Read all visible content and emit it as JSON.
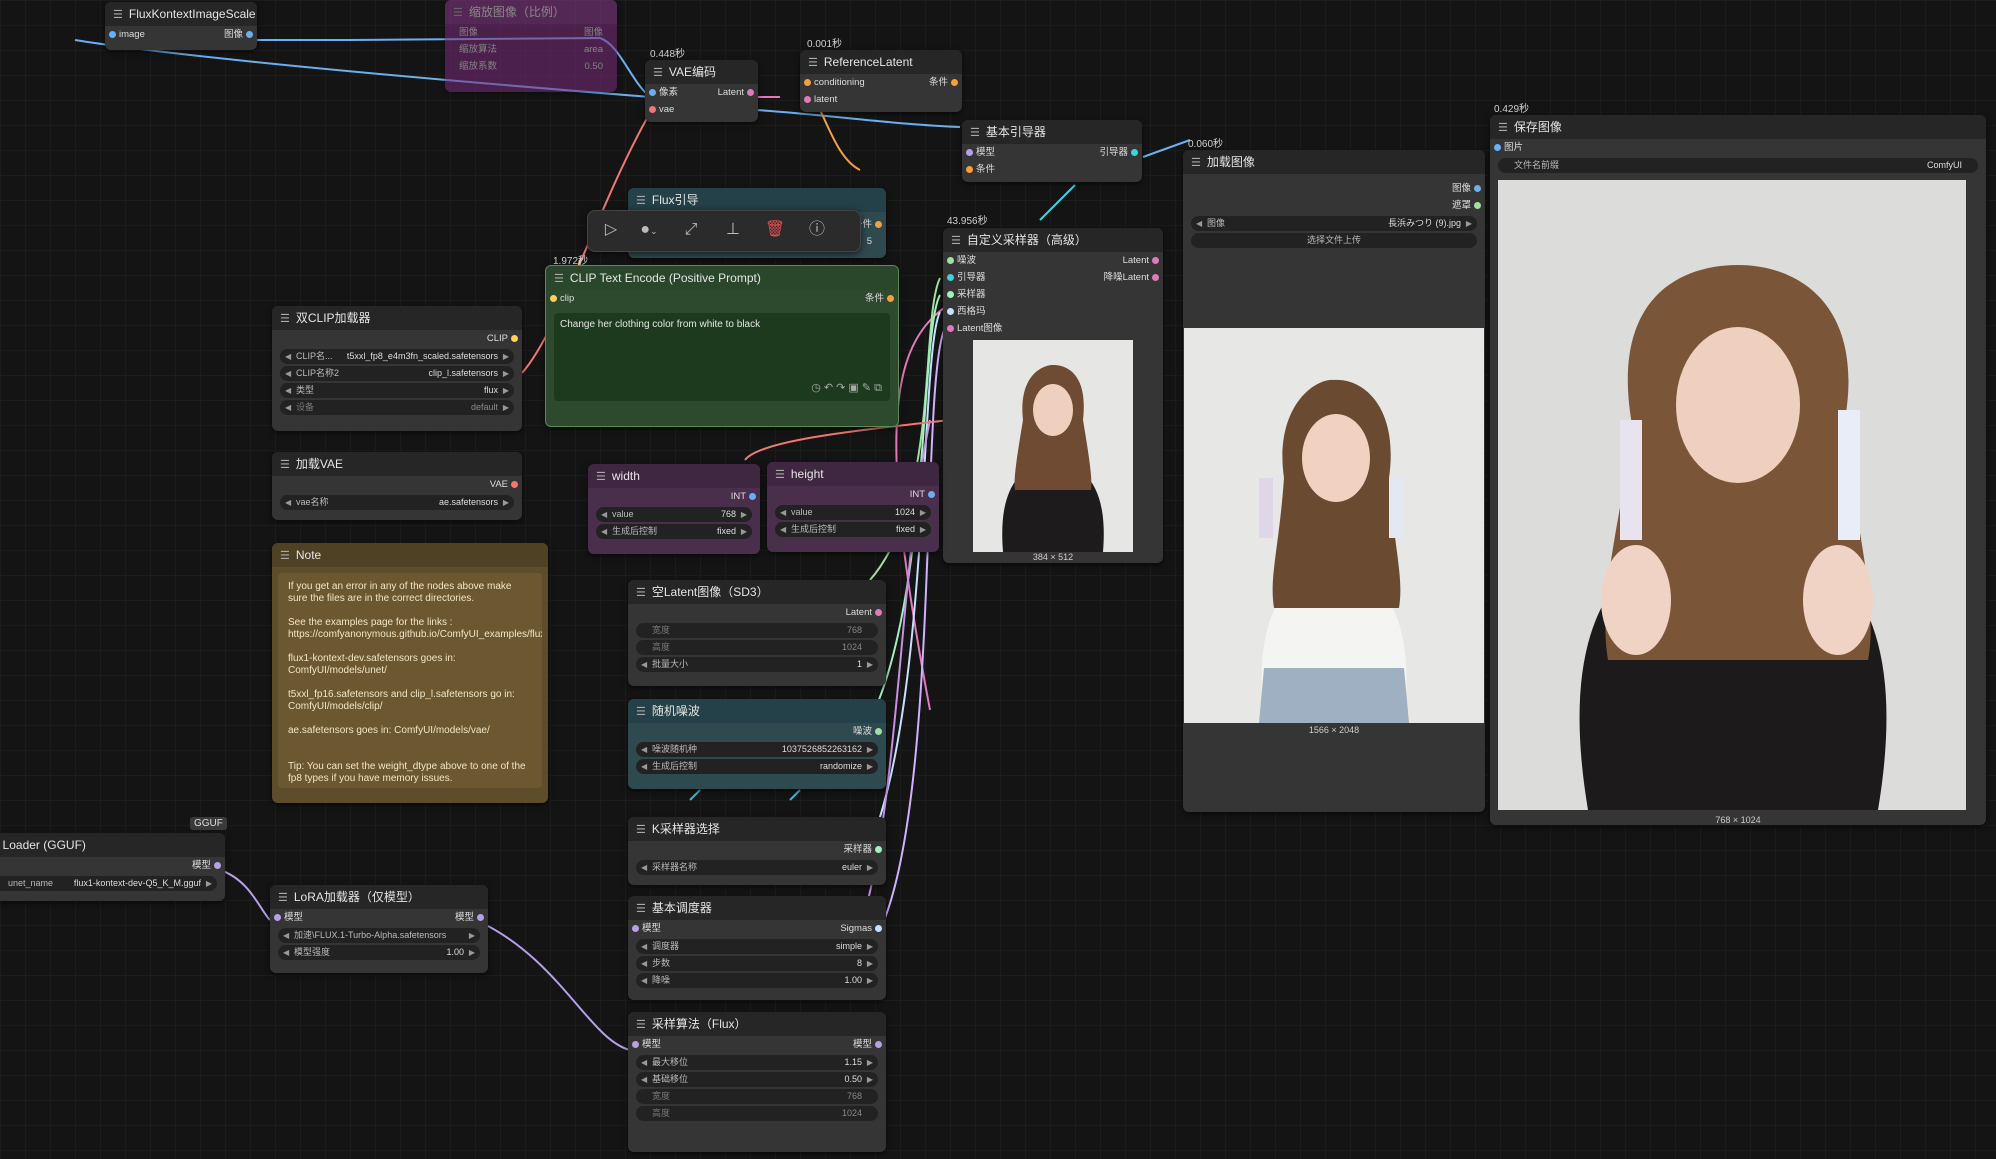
{
  "nodes": {
    "flux_kontext_scale": {
      "title": "FluxKontextImageScale",
      "in": "image",
      "out": "图像"
    },
    "bypassed_scale": {
      "title": "缩放图像（比例）",
      "r1": "图像",
      "r2a": "缩放算法",
      "r2b": "area",
      "r3a": "缩放系数",
      "r3b": "0.50"
    },
    "vae_encode": {
      "timing": "0.448秒",
      "title": "VAE编码",
      "in1": "像素",
      "in2": "vae",
      "out": "Latent"
    },
    "ref_latent": {
      "timing": "0.001秒",
      "title": "ReferenceLatent",
      "in1": "conditioning",
      "in2": "latent",
      "out": "条件"
    },
    "basic_guider": {
      "title": "基本引导器",
      "in1": "模型",
      "in2": "条件",
      "out": "引导器"
    },
    "load_image": {
      "timing": "0.060秒",
      "title": "加载图像",
      "out1": "图像",
      "out2": "遮罩",
      "w_key": "图像",
      "w_val": "長浜みつり (9).jpg",
      "upload": "选择文件上传",
      "size": "1566 × 2048"
    },
    "save_image": {
      "timing": "0.429秒",
      "title": "保存图像",
      "in": "图片",
      "w_key": "文件名前缀",
      "w_val": "ComfyUI",
      "size": "768 × 1024"
    },
    "flux_guidance": {
      "title": "Flux引导",
      "out": "条件",
      "partial": "5"
    },
    "clip_text": {
      "timing": "1.972秒",
      "title": "CLIP Text Encode (Positive Prompt)",
      "in": "clip",
      "out": "条件",
      "text": "Change her clothing color from white to black"
    },
    "custom_sampler": {
      "timing": "43.956秒",
      "title": "自定义采样器（高级）",
      "in1": "噪波",
      "in2": "引导器",
      "in3": "采样器",
      "in4": "西格玛",
      "in5": "Latent图像",
      "out1": "Latent",
      "out2": "降噪Latent",
      "size": "384 × 512"
    },
    "dual_clip": {
      "title": "双CLIP加载器",
      "out": "CLIP",
      "w1k": "CLIP名...",
      "w1v": "t5xxl_fp8_e4m3fn_scaled.safetensors",
      "w2k": "CLIP名称2",
      "w2v": "clip_l.safetensors",
      "w3k": "类型",
      "w3v": "flux",
      "w4k": "设备",
      "w4v": "default"
    },
    "load_vae": {
      "title": "加载VAE",
      "out": "VAE",
      "wk": "vae名称",
      "wv": "ae.safetensors"
    },
    "width": {
      "title": "width",
      "out": "INT",
      "w1k": "value",
      "w1v": "768",
      "w2k": "生成后控制",
      "w2v": "fixed"
    },
    "height": {
      "title": "height",
      "out": "INT",
      "w1k": "value",
      "w1v": "1024",
      "w2k": "生成后控制",
      "w2v": "fixed"
    },
    "note": {
      "title": "Note",
      "text": "If you get an error in any of the nodes above make sure the files are in the correct directories.\n\nSee the examples page for the links : https://comfyanonymous.github.io/ComfyUI_examples/flux/\n\nflux1-kontext-dev.safetensors goes in: ComfyUI/models/unet/\n\nt5xxl_fp16.safetensors and clip_l.safetensors go in: ComfyUI/models/clip/\n\nae.safetensors goes in: ComfyUI/models/vae/\n\n\nTip: You can set the weight_dtype above to one of the fp8 types if you have memory issues."
    },
    "empty_latent": {
      "title": "空Latent图像（SD3）",
      "out": "Latent",
      "w1k": "宽度",
      "w1v": "768",
      "w2k": "高度",
      "w2v": "1024",
      "w3k": "批量大小",
      "w3v": "1"
    },
    "random_noise": {
      "title": "随机噪波",
      "out": "噪波",
      "w1k": "噪波随机种",
      "w1v": "1037526852263162",
      "w2k": "生成后控制",
      "w2v": "randomize"
    },
    "unet_loader": {
      "badge": "GGUF",
      "title": "Unet Loader (GGUF)",
      "out": "模型",
      "wk": "unet_name",
      "wv": "flux1-kontext-dev-Q5_K_M.gguf"
    },
    "lora": {
      "title": "LoRA加载器（仅模型）",
      "in": "模型",
      "out": "模型",
      "w1k": "加速\\FLUX.1-Turbo-Alpha.safetensors",
      "w2k": "模型强度",
      "w2v": "1.00"
    },
    "ksampler_select": {
      "title": "K采样器选择",
      "out": "采样器",
      "wk": "采样器名称",
      "wv": "euler"
    },
    "basic_scheduler": {
      "title": "基本调度器",
      "in": "模型",
      "out": "Sigmas",
      "w1k": "调度器",
      "w1v": "simple",
      "w2k": "步数",
      "w2v": "8",
      "w3k": "降噪",
      "w3v": "1.00"
    },
    "model_sampling": {
      "title": "采样算法（Flux）",
      "in": "模型",
      "out": "模型",
      "w1k": "最大移位",
      "w1v": "1.15",
      "w2k": "基础移位",
      "w2v": "0.50",
      "w3k": "宽度",
      "w3v": "768",
      "w4k": "高度",
      "w4v": "1024"
    }
  },
  "colors": {
    "accent_green": "#2e4a2e",
    "note_bg": "#5e4d2b",
    "purple": "#4a2f4d",
    "teal": "#2f4a4f",
    "bypass": "#7a2a7a"
  },
  "toolbar_icons": [
    "play-icon",
    "color-circle-icon",
    "bypass-icon",
    "pin-icon",
    "delete-icon",
    "help-icon"
  ]
}
